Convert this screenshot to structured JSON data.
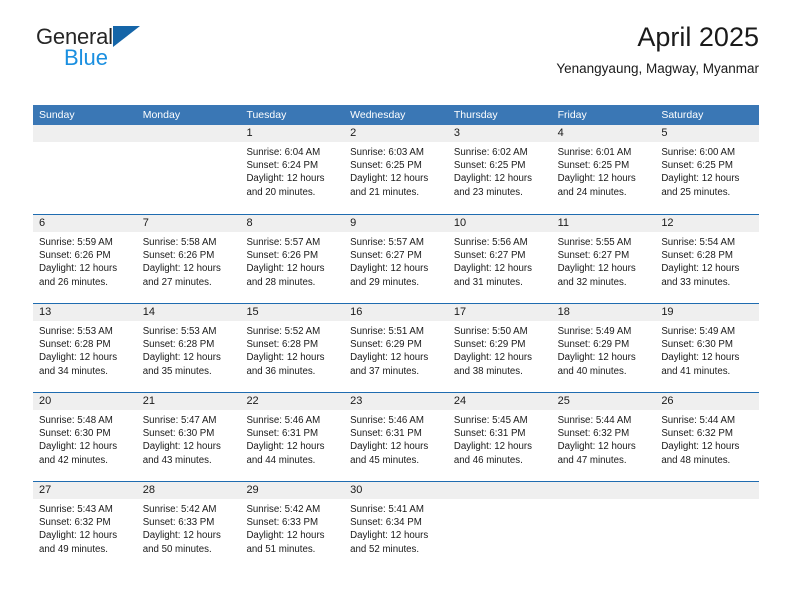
{
  "brand": {
    "name_part1": "General",
    "name_part2": "Blue",
    "logo_icon": "triangle-logo-icon"
  },
  "header": {
    "title": "April 2025",
    "subtitle": "Yenangyaung, Magway, Myanmar"
  },
  "colors": {
    "header_blue": "#3a77b5",
    "row_divider_blue": "#1f6cb0",
    "date_strip_gray": "#efefef",
    "brand_blue": "#1a8fe0",
    "brand_triangle": "#1565a8",
    "text": "#1a1a1a"
  },
  "weekdays": [
    "Sunday",
    "Monday",
    "Tuesday",
    "Wednesday",
    "Thursday",
    "Friday",
    "Saturday"
  ],
  "weeks": [
    [
      {
        "day": "",
        "empty": true,
        "lines": []
      },
      {
        "day": "",
        "empty": true,
        "lines": []
      },
      {
        "day": "1",
        "empty": false,
        "lines": [
          "Sunrise: 6:04 AM",
          "Sunset: 6:24 PM",
          "Daylight: 12 hours",
          "and 20 minutes."
        ]
      },
      {
        "day": "2",
        "empty": false,
        "lines": [
          "Sunrise: 6:03 AM",
          "Sunset: 6:25 PM",
          "Daylight: 12 hours",
          "and 21 minutes."
        ]
      },
      {
        "day": "3",
        "empty": false,
        "lines": [
          "Sunrise: 6:02 AM",
          "Sunset: 6:25 PM",
          "Daylight: 12 hours",
          "and 23 minutes."
        ]
      },
      {
        "day": "4",
        "empty": false,
        "lines": [
          "Sunrise: 6:01 AM",
          "Sunset: 6:25 PM",
          "Daylight: 12 hours",
          "and 24 minutes."
        ]
      },
      {
        "day": "5",
        "empty": false,
        "lines": [
          "Sunrise: 6:00 AM",
          "Sunset: 6:25 PM",
          "Daylight: 12 hours",
          "and 25 minutes."
        ]
      }
    ],
    [
      {
        "day": "6",
        "empty": false,
        "lines": [
          "Sunrise: 5:59 AM",
          "Sunset: 6:26 PM",
          "Daylight: 12 hours",
          "and 26 minutes."
        ]
      },
      {
        "day": "7",
        "empty": false,
        "lines": [
          "Sunrise: 5:58 AM",
          "Sunset: 6:26 PM",
          "Daylight: 12 hours",
          "and 27 minutes."
        ]
      },
      {
        "day": "8",
        "empty": false,
        "lines": [
          "Sunrise: 5:57 AM",
          "Sunset: 6:26 PM",
          "Daylight: 12 hours",
          "and 28 minutes."
        ]
      },
      {
        "day": "9",
        "empty": false,
        "lines": [
          "Sunrise: 5:57 AM",
          "Sunset: 6:27 PM",
          "Daylight: 12 hours",
          "and 29 minutes."
        ]
      },
      {
        "day": "10",
        "empty": false,
        "lines": [
          "Sunrise: 5:56 AM",
          "Sunset: 6:27 PM",
          "Daylight: 12 hours",
          "and 31 minutes."
        ]
      },
      {
        "day": "11",
        "empty": false,
        "lines": [
          "Sunrise: 5:55 AM",
          "Sunset: 6:27 PM",
          "Daylight: 12 hours",
          "and 32 minutes."
        ]
      },
      {
        "day": "12",
        "empty": false,
        "lines": [
          "Sunrise: 5:54 AM",
          "Sunset: 6:28 PM",
          "Daylight: 12 hours",
          "and 33 minutes."
        ]
      }
    ],
    [
      {
        "day": "13",
        "empty": false,
        "lines": [
          "Sunrise: 5:53 AM",
          "Sunset: 6:28 PM",
          "Daylight: 12 hours",
          "and 34 minutes."
        ]
      },
      {
        "day": "14",
        "empty": false,
        "lines": [
          "Sunrise: 5:53 AM",
          "Sunset: 6:28 PM",
          "Daylight: 12 hours",
          "and 35 minutes."
        ]
      },
      {
        "day": "15",
        "empty": false,
        "lines": [
          "Sunrise: 5:52 AM",
          "Sunset: 6:28 PM",
          "Daylight: 12 hours",
          "and 36 minutes."
        ]
      },
      {
        "day": "16",
        "empty": false,
        "lines": [
          "Sunrise: 5:51 AM",
          "Sunset: 6:29 PM",
          "Daylight: 12 hours",
          "and 37 minutes."
        ]
      },
      {
        "day": "17",
        "empty": false,
        "lines": [
          "Sunrise: 5:50 AM",
          "Sunset: 6:29 PM",
          "Daylight: 12 hours",
          "and 38 minutes."
        ]
      },
      {
        "day": "18",
        "empty": false,
        "lines": [
          "Sunrise: 5:49 AM",
          "Sunset: 6:29 PM",
          "Daylight: 12 hours",
          "and 40 minutes."
        ]
      },
      {
        "day": "19",
        "empty": false,
        "lines": [
          "Sunrise: 5:49 AM",
          "Sunset: 6:30 PM",
          "Daylight: 12 hours",
          "and 41 minutes."
        ]
      }
    ],
    [
      {
        "day": "20",
        "empty": false,
        "lines": [
          "Sunrise: 5:48 AM",
          "Sunset: 6:30 PM",
          "Daylight: 12 hours",
          "and 42 minutes."
        ]
      },
      {
        "day": "21",
        "empty": false,
        "lines": [
          "Sunrise: 5:47 AM",
          "Sunset: 6:30 PM",
          "Daylight: 12 hours",
          "and 43 minutes."
        ]
      },
      {
        "day": "22",
        "empty": false,
        "lines": [
          "Sunrise: 5:46 AM",
          "Sunset: 6:31 PM",
          "Daylight: 12 hours",
          "and 44 minutes."
        ]
      },
      {
        "day": "23",
        "empty": false,
        "lines": [
          "Sunrise: 5:46 AM",
          "Sunset: 6:31 PM",
          "Daylight: 12 hours",
          "and 45 minutes."
        ]
      },
      {
        "day": "24",
        "empty": false,
        "lines": [
          "Sunrise: 5:45 AM",
          "Sunset: 6:31 PM",
          "Daylight: 12 hours",
          "and 46 minutes."
        ]
      },
      {
        "day": "25",
        "empty": false,
        "lines": [
          "Sunrise: 5:44 AM",
          "Sunset: 6:32 PM",
          "Daylight: 12 hours",
          "and 47 minutes."
        ]
      },
      {
        "day": "26",
        "empty": false,
        "lines": [
          "Sunrise: 5:44 AM",
          "Sunset: 6:32 PM",
          "Daylight: 12 hours",
          "and 48 minutes."
        ]
      }
    ],
    [
      {
        "day": "27",
        "empty": false,
        "lines": [
          "Sunrise: 5:43 AM",
          "Sunset: 6:32 PM",
          "Daylight: 12 hours",
          "and 49 minutes."
        ]
      },
      {
        "day": "28",
        "empty": false,
        "lines": [
          "Sunrise: 5:42 AM",
          "Sunset: 6:33 PM",
          "Daylight: 12 hours",
          "and 50 minutes."
        ]
      },
      {
        "day": "29",
        "empty": false,
        "lines": [
          "Sunrise: 5:42 AM",
          "Sunset: 6:33 PM",
          "Daylight: 12 hours",
          "and 51 minutes."
        ]
      },
      {
        "day": "30",
        "empty": false,
        "lines": [
          "Sunrise: 5:41 AM",
          "Sunset: 6:34 PM",
          "Daylight: 12 hours",
          "and 52 minutes."
        ]
      },
      {
        "day": "",
        "empty": true,
        "lines": []
      },
      {
        "day": "",
        "empty": true,
        "lines": []
      },
      {
        "day": "",
        "empty": true,
        "lines": []
      }
    ]
  ]
}
